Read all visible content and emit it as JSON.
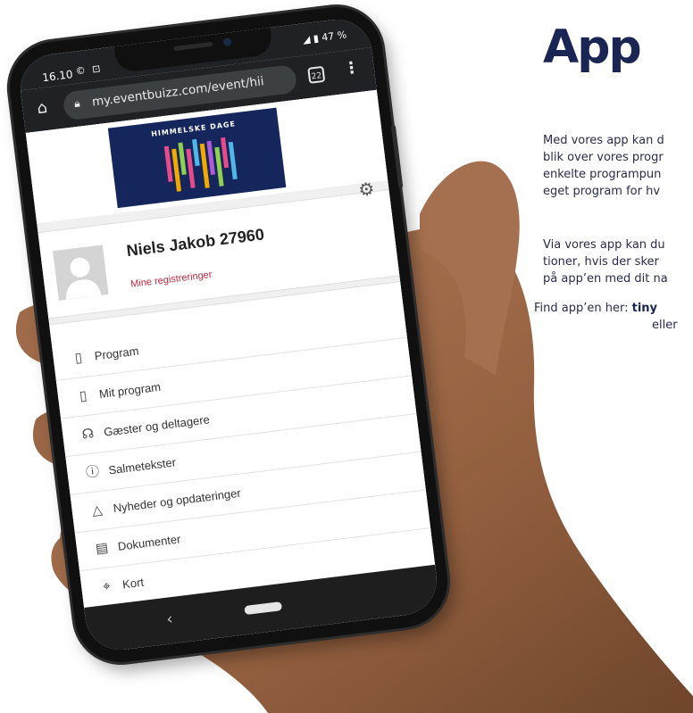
{
  "page": {
    "heading": "App",
    "paragraph1": [
      "Med vores app kan d",
      "blik over vores progr",
      "enkelte programpun",
      "eget program for hv"
    ],
    "paragraph2": [
      "Via vores app kan du",
      "tioner, hvis der sker",
      "på app’en med dit na"
    ],
    "find_prefix": "Find app’en her: ",
    "find_link": "tiny",
    "find_suffix": "eller"
  },
  "phone": {
    "status": {
      "time": "16.10",
      "apps": "© ⊡",
      "battery": "◢ ▮ 47 %"
    },
    "browser": {
      "url": "my.eventbuizz.com/event/hii",
      "tab_count": "22"
    },
    "banner": {
      "title": "HIMMELSKE DAGE"
    },
    "profile": {
      "name": "Niels Jakob 27960",
      "registrations": "Mine registreringer"
    },
    "menu": [
      {
        "icon": "book-icon",
        "label": "Program"
      },
      {
        "icon": "book-icon",
        "label": "Mit program"
      },
      {
        "icon": "person-icon",
        "label": "Gæster og deltagere"
      },
      {
        "icon": "info-icon",
        "label": "Salmetekster"
      },
      {
        "icon": "bell-icon",
        "label": "Nyheder og opdateringer"
      },
      {
        "icon": "document-icon",
        "label": "Dokumenter"
      },
      {
        "icon": "map-icon",
        "label": "Kort"
      }
    ]
  },
  "colors": {
    "heading": "#1a2553",
    "accent_red": "#c0283f",
    "banner_bg": "#15265c"
  }
}
